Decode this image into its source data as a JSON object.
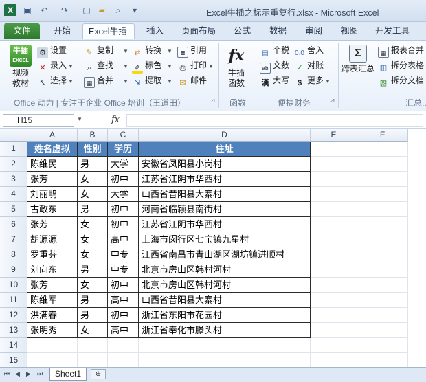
{
  "window": {
    "title": "Excel牛插之标示重复行.xlsx  -  Microsoft Excel",
    "app_icon": "X"
  },
  "quick_access": {
    "save": "💾",
    "undo": "↶",
    "redo": "↷",
    "new": "▢",
    "open": "📂",
    "print_preview": "🔍",
    "customize": "▾"
  },
  "tabs": [
    "文件",
    "开始",
    "Excel牛插",
    "插入",
    "页面布局",
    "公式",
    "数据",
    "审阅",
    "视图",
    "开发工具"
  ],
  "ribbon": {
    "video": {
      "badge": "牛插",
      "badge_sub": "EXCEL",
      "label1": "视频",
      "label2": "教材"
    },
    "settings": "设置",
    "record": "录入",
    "select": "选择",
    "copy": "复制",
    "find": "查找",
    "merge": "合并",
    "convert": "转换",
    "mark": "标色",
    "extract": "提取",
    "quote": "引用",
    "print": "打印",
    "mail": "邮件",
    "niucha_func": {
      "icon": "fx",
      "label1": "牛插",
      "label2": "函数"
    },
    "tax": "个税",
    "text": "文数",
    "bigcase": "大写",
    "round": "舍入",
    "check": "对账",
    "more": "更多",
    "cross_summary": "跨表汇总",
    "report_merge": "报表合并",
    "split_table": "拆分表格",
    "split_doc": "拆分文档",
    "group_office": "Office 动力 | 专注于企业 Office 培训（王道田）",
    "group_func": "函数",
    "group_finance": "便捷财务",
    "group_summary": "汇总..."
  },
  "formula_bar": {
    "name_box": "H15",
    "fx": "fx",
    "value": ""
  },
  "columns": [
    "A",
    "B",
    "C",
    "D",
    "E",
    "F"
  ],
  "rows": [
    "1",
    "2",
    "3",
    "4",
    "5",
    "6",
    "7",
    "8",
    "9",
    "10",
    "11",
    "12",
    "13",
    "14",
    "15"
  ],
  "table": {
    "headers": [
      "姓名虚拟",
      "性别",
      "学历",
      "住址"
    ],
    "data": [
      [
        "陈维民",
        "男",
        "大学",
        "安徽省凤阳县小岗村"
      ],
      [
        "张芳",
        "女",
        "初中",
        "江苏省江阴市华西村"
      ],
      [
        "刘丽鹃",
        "女",
        "大学",
        "山西省昔阳县大寨村"
      ],
      [
        "古政东",
        "男",
        "初中",
        "河南省临颍县南街村"
      ],
      [
        "张芳",
        "女",
        "初中",
        "江苏省江阴市华西村"
      ],
      [
        "胡源源",
        "女",
        "高中",
        "上海市闵行区七宝镇九星村"
      ],
      [
        "罗重芬",
        "女",
        "中专",
        "江西省南昌市青山湖区湖坊镇进顺村"
      ],
      [
        "刘向东",
        "男",
        "中专",
        "北京市房山区韩村河村"
      ],
      [
        "张芳",
        "女",
        "初中",
        "北京市房山区韩村河村"
      ],
      [
        "陈维军",
        "男",
        "高中",
        "山西省昔阳县大寨村"
      ],
      [
        "洪满春",
        "男",
        "初中",
        "浙江省东阳市花园村"
      ],
      [
        "张明秀",
        "女",
        "高中",
        "浙江省奉化市滕头村"
      ]
    ]
  },
  "sheets": {
    "active": "Sheet1",
    "nav": [
      "⏮",
      "◀",
      "▶",
      "⏭"
    ],
    "new_sheet_icon": "⊕"
  },
  "colors": {
    "header_fill": "#4f81bd",
    "file_tab": "#2d7a2e",
    "ribbon_bg": "#e8f0fa"
  }
}
